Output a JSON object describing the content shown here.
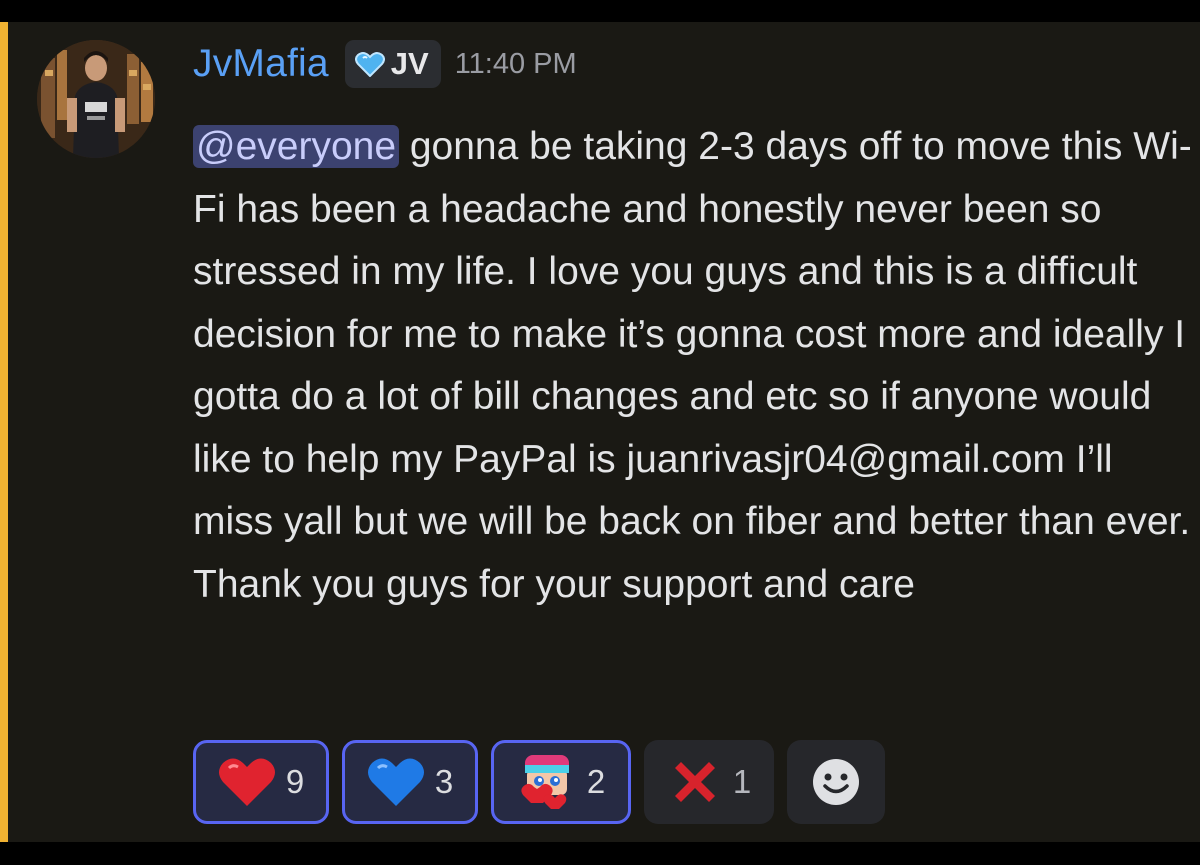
{
  "colors": {
    "background": "#1a1914",
    "mention_bar": "#f0b232",
    "username": "#5aa0f5",
    "mention_bg": "#3c4270",
    "reaction_active_border": "#5865f2"
  },
  "message": {
    "author": "JvMafia",
    "avatar_icon": "user-avatar-photo",
    "role_tag": {
      "icon": "blue-heart-icon",
      "text": "JV"
    },
    "timestamp": "11:40 PM",
    "mention": "@everyone",
    "body": " gonna be taking 2-3 days off to move this Wi-Fi has been a headache and honestly never been so stressed in my life. I love you guys and this is a difficult decision for me to make it’s gonna cost more and ideally I gotta do a lot of bill changes and etc so if anyone would like to help my PayPal is juanrivasjr04@gmail.com I’ll miss yall but we will be back on fiber and better than ever. Thank you guys for your support and care"
  },
  "reactions": [
    {
      "emoji": "red-heart-icon",
      "count": "9",
      "reacted": true
    },
    {
      "emoji": "blue-heart-icon",
      "count": "3",
      "reacted": true
    },
    {
      "emoji": "custom-character-heart-emoji",
      "count": "2",
      "reacted": true
    },
    {
      "emoji": "red-x-icon",
      "count": "1",
      "reacted": false
    }
  ],
  "add_reaction_icon": "add-reaction-smiley-icon"
}
